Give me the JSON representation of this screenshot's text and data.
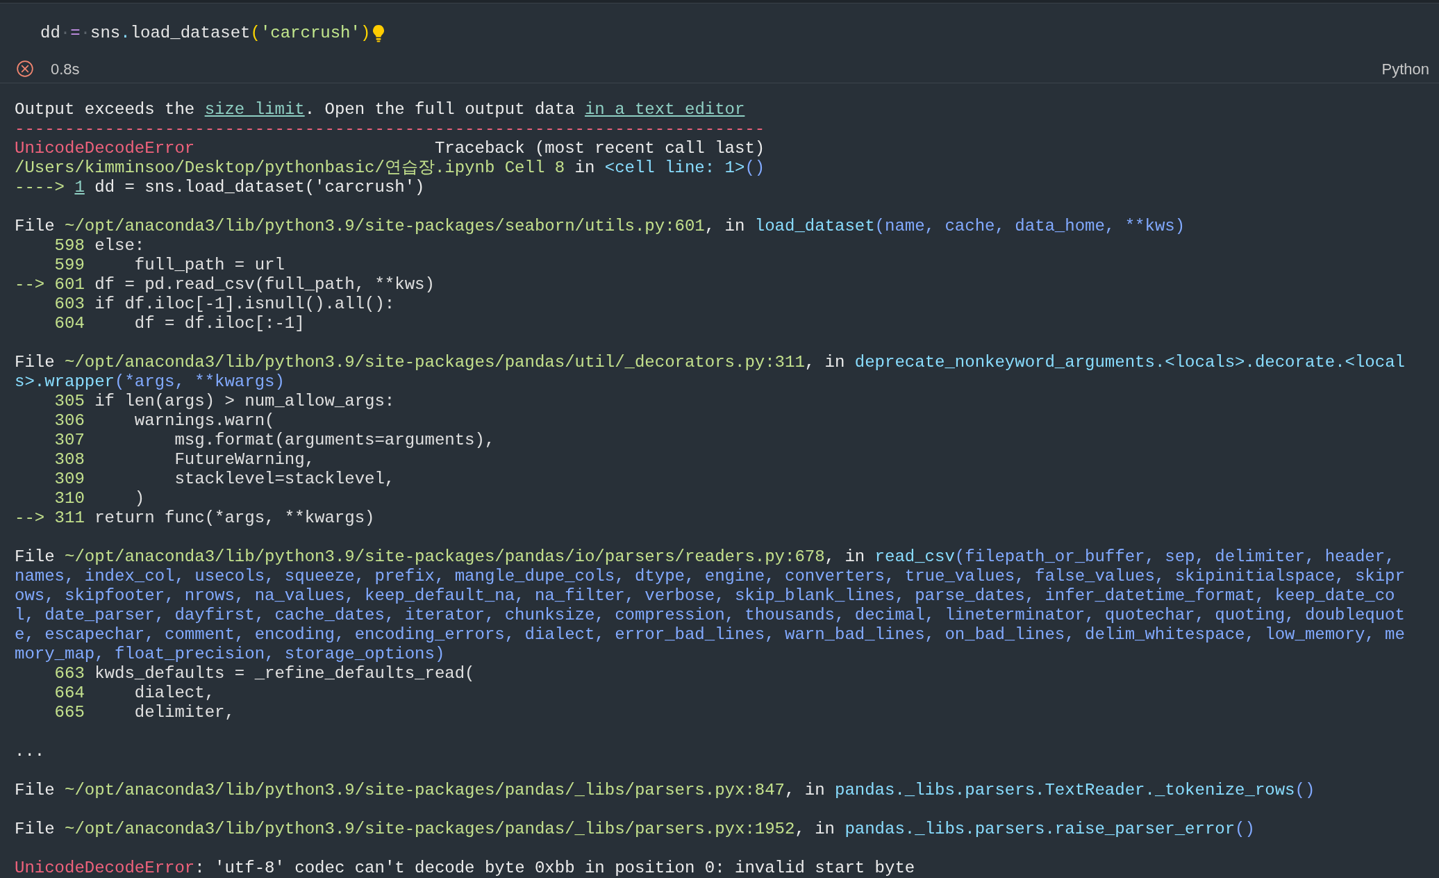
{
  "cell": {
    "code": [
      {
        "kind": "ident",
        "text": "dd"
      },
      {
        "kind": "space",
        "text": "·"
      },
      {
        "kind": "operator",
        "text": "="
      },
      {
        "kind": "space",
        "text": "·"
      },
      {
        "kind": "ident",
        "text": "sns"
      },
      {
        "kind": "dot",
        "text": "."
      },
      {
        "kind": "ident",
        "text": "load_dataset"
      },
      {
        "kind": "bracket",
        "text": "("
      },
      {
        "kind": "string",
        "text": "'carcrush'"
      },
      {
        "kind": "bracket",
        "text": ")"
      }
    ],
    "status": {
      "kind": "error",
      "duration": "0.8s"
    },
    "language": "Python"
  },
  "output": {
    "blocks": [
      {
        "lines": [
          [
            {
              "kind": "plain",
              "text": "Output exceeds the "
            },
            {
              "kind": "link",
              "text": "size limit"
            },
            {
              "kind": "plain",
              "text": ". Open the full output data "
            },
            {
              "kind": "link",
              "text": "in a text editor"
            }
          ],
          [
            {
              "kind": "error",
              "text": "---------------------------------------------------------------------------"
            }
          ],
          [
            {
              "kind": "error",
              "text": "UnicodeDecodeError"
            },
            {
              "kind": "plain",
              "text": "                        Traceback (most recent call last)"
            }
          ],
          [
            {
              "kind": "path",
              "text": "/Users/kimminsoo/Desktop/pythonbasic/연습장.ipynb Cell 8"
            },
            {
              "kind": "plain",
              "text": " in "
            },
            {
              "kind": "func",
              "text": "<cell line: 1>"
            },
            {
              "kind": "args",
              "text": "()"
            }
          ],
          [
            {
              "kind": "path",
              "text": "----> "
            },
            {
              "kind": "link",
              "text": "1"
            },
            {
              "kind": "plain",
              "text": " dd = sns.load_dataset('carcrush')"
            }
          ]
        ]
      },
      {
        "lines": [
          [
            {
              "kind": "plain",
              "text": "File "
            },
            {
              "kind": "path",
              "text": "~/opt/anaconda3/lib/python3.9/site-packages/seaborn/utils.py:601"
            },
            {
              "kind": "plain",
              "text": ", in "
            },
            {
              "kind": "func",
              "text": "load_dataset"
            },
            {
              "kind": "args",
              "text": "(name, cache, data_home, **kws)"
            }
          ],
          [
            {
              "kind": "lineno",
              "text": "598"
            },
            {
              "kind": "code",
              "text": "else:"
            }
          ],
          [
            {
              "kind": "lineno",
              "text": "599"
            },
            {
              "kind": "code",
              "text": "    full_path = url"
            }
          ],
          [
            {
              "kind": "arrow",
              "text": "-->"
            },
            {
              "kind": "lineno",
              "text": "601"
            },
            {
              "kind": "code",
              "text": "df = pd.read_csv(full_path, **kws)"
            }
          ],
          [
            {
              "kind": "lineno",
              "text": "603"
            },
            {
              "kind": "code",
              "text": "if df.iloc[-1].isnull().all():"
            }
          ],
          [
            {
              "kind": "lineno",
              "text": "604"
            },
            {
              "kind": "code",
              "text": "    df = df.iloc[:-1]"
            }
          ]
        ]
      },
      {
        "lines": [
          [
            {
              "kind": "plain",
              "text": "File "
            },
            {
              "kind": "path",
              "text": "~/opt/anaconda3/lib/python3.9/site-packages/pandas/util/_decorators.py:311"
            },
            {
              "kind": "plain",
              "text": ", in "
            },
            {
              "kind": "func",
              "text": "deprecate_nonkeyword_arguments.<locals>.decorate.<local"
            }
          ],
          [
            {
              "kind": "func",
              "text": "s>.wrapper"
            },
            {
              "kind": "args",
              "text": "(*args, **kwargs)"
            }
          ],
          [
            {
              "kind": "lineno",
              "text": "305"
            },
            {
              "kind": "code",
              "text": "if len(args) > num_allow_args:"
            }
          ],
          [
            {
              "kind": "lineno",
              "text": "306"
            },
            {
              "kind": "code",
              "text": "    warnings.warn("
            }
          ],
          [
            {
              "kind": "lineno",
              "text": "307"
            },
            {
              "kind": "code",
              "text": "        msg.format(arguments=arguments),"
            }
          ],
          [
            {
              "kind": "lineno",
              "text": "308"
            },
            {
              "kind": "code",
              "text": "        FutureWarning,"
            }
          ],
          [
            {
              "kind": "lineno",
              "text": "309"
            },
            {
              "kind": "code",
              "text": "        stacklevel=stacklevel,"
            }
          ],
          [
            {
              "kind": "lineno",
              "text": "310"
            },
            {
              "kind": "code",
              "text": "    )"
            }
          ],
          [
            {
              "kind": "arrow",
              "text": "-->"
            },
            {
              "kind": "lineno",
              "text": "311"
            },
            {
              "kind": "code",
              "text": "return func(*args, **kwargs)"
            }
          ]
        ]
      },
      {
        "lines": [
          [
            {
              "kind": "plain",
              "text": "File "
            },
            {
              "kind": "path",
              "text": "~/opt/anaconda3/lib/python3.9/site-packages/pandas/io/parsers/readers.py:678"
            },
            {
              "kind": "plain",
              "text": ", in "
            },
            {
              "kind": "func",
              "text": "read_csv"
            },
            {
              "kind": "args",
              "text": "(filepath_or_buffer, sep, delimiter, header,"
            }
          ],
          [
            {
              "kind": "args",
              "text": "names, index_col, usecols, squeeze, prefix, mangle_dupe_cols, dtype, engine, converters, true_values, false_values, skipinitialspace, skipr"
            }
          ],
          [
            {
              "kind": "args",
              "text": "ows, skipfooter, nrows, na_values, keep_default_na, na_filter, verbose, skip_blank_lines, parse_dates, infer_datetime_format, keep_date_co"
            }
          ],
          [
            {
              "kind": "args",
              "text": "l, date_parser, dayfirst, cache_dates, iterator, chunksize, compression, thousands, decimal, lineterminator, quotechar, quoting, doublequot"
            }
          ],
          [
            {
              "kind": "args",
              "text": "e, escapechar, comment, encoding, encoding_errors, dialect, error_bad_lines, warn_bad_lines, on_bad_lines, delim_whitespace, low_memory, me"
            }
          ],
          [
            {
              "kind": "args",
              "text": "mory_map, float_precision, storage_options)"
            }
          ],
          [
            {
              "kind": "lineno",
              "text": "663"
            },
            {
              "kind": "code",
              "text": "kwds_defaults = _refine_defaults_read("
            }
          ],
          [
            {
              "kind": "lineno",
              "text": "664"
            },
            {
              "kind": "code",
              "text": "    dialect,"
            }
          ],
          [
            {
              "kind": "lineno",
              "text": "665"
            },
            {
              "kind": "code",
              "text": "    delimiter,"
            }
          ]
        ]
      },
      {
        "lines": [
          [
            {
              "kind": "plain",
              "text": "..."
            }
          ]
        ]
      },
      {
        "lines": [
          [
            {
              "kind": "plain",
              "text": "File "
            },
            {
              "kind": "path",
              "text": "~/opt/anaconda3/lib/python3.9/site-packages/pandas/_libs/parsers.pyx:847"
            },
            {
              "kind": "plain",
              "text": ", in "
            },
            {
              "kind": "func",
              "text": "pandas._libs.parsers.TextReader._tokenize_rows"
            },
            {
              "kind": "args",
              "text": "()"
            }
          ]
        ]
      },
      {
        "lines": [
          [
            {
              "kind": "plain",
              "text": "File "
            },
            {
              "kind": "path",
              "text": "~/opt/anaconda3/lib/python3.9/site-packages/pandas/_libs/parsers.pyx:1952"
            },
            {
              "kind": "plain",
              "text": ", in "
            },
            {
              "kind": "func",
              "text": "pandas._libs.parsers.raise_parser_error"
            },
            {
              "kind": "args",
              "text": "()"
            }
          ]
        ]
      },
      {
        "lines": [
          [
            {
              "kind": "error",
              "text": "UnicodeDecodeError"
            },
            {
              "kind": "plain",
              "text": ": 'utf-8' codec can't decode byte 0xbb in position 0: invalid start byte"
            }
          ]
        ]
      }
    ]
  }
}
